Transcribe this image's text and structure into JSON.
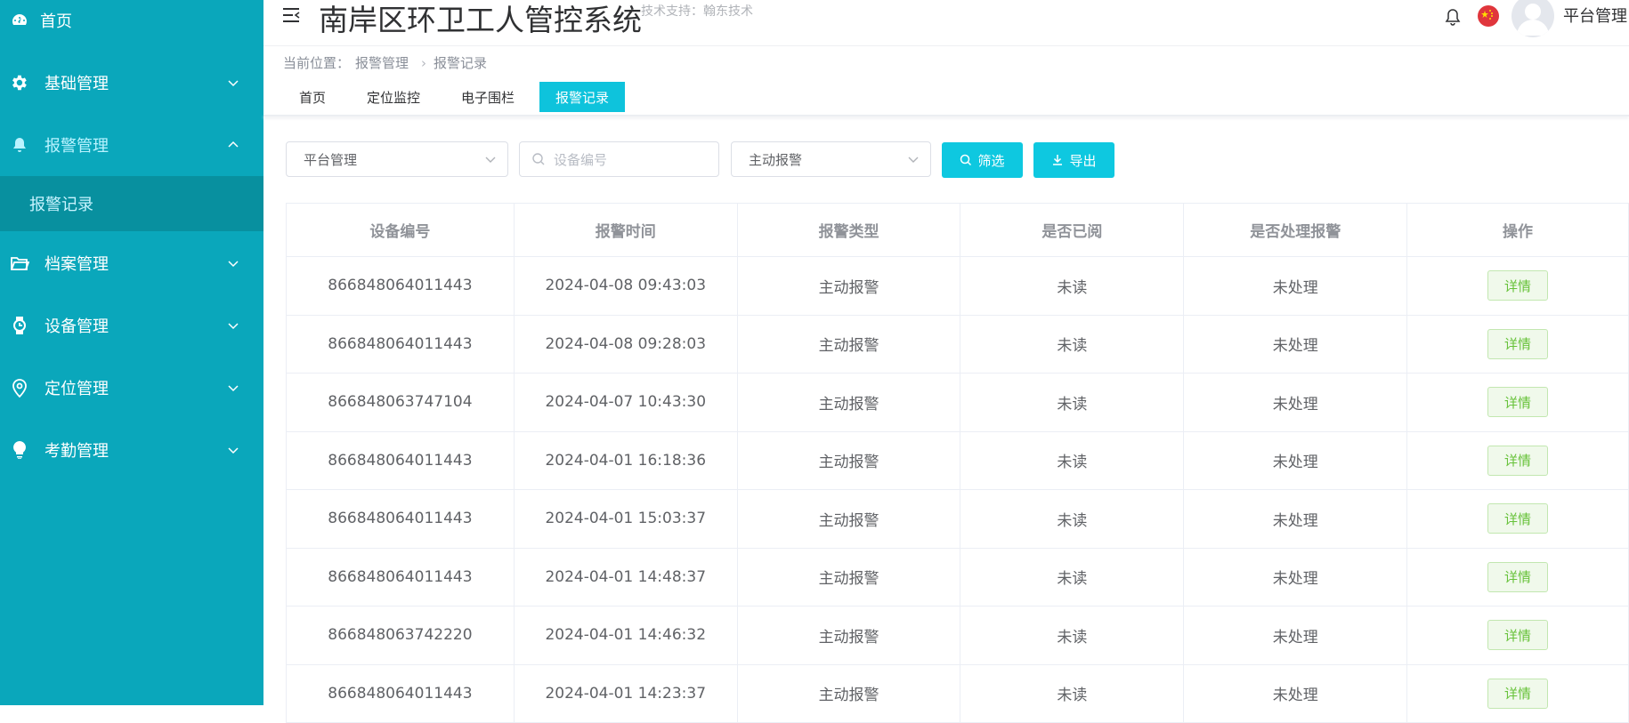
{
  "sidebar": {
    "items": [
      {
        "label": "首页",
        "icon": "dashboard-icon"
      },
      {
        "label": "基础管理",
        "icon": "gear-icon"
      },
      {
        "label": "报警管理",
        "icon": "bell-icon"
      },
      {
        "label": "档案管理",
        "icon": "folder-icon"
      },
      {
        "label": "设备管理",
        "icon": "watch-icon"
      },
      {
        "label": "定位管理",
        "icon": "location-icon"
      },
      {
        "label": "考勤管理",
        "icon": "bulb-icon"
      }
    ],
    "submenu": {
      "label": "报警记录"
    }
  },
  "header": {
    "title": "南岸区环卫工人管控系统",
    "tech_support": "技术支持：翰东技术",
    "user": "平台管理"
  },
  "breadcrumb": {
    "prefix": "当前位置：",
    "items": [
      "报警管理",
      "报警记录"
    ]
  },
  "tabs": [
    "首页",
    "定位监控",
    "电子围栏",
    "报警记录"
  ],
  "filters": {
    "org_select": "平台管理",
    "device_placeholder": "设备编号",
    "type_select": "主动报警",
    "filter_button": "筛选",
    "export_button": "导出"
  },
  "table": {
    "headers": [
      "设备编号",
      "报警时间",
      "报警类型",
      "是否已阅",
      "是否处理报警",
      "操作"
    ],
    "rows": [
      [
        "866848064011443",
        "2024-04-08 09:43:03",
        "主动报警",
        "未读",
        "未处理",
        "详情"
      ],
      [
        "866848064011443",
        "2024-04-08 09:28:03",
        "主动报警",
        "未读",
        "未处理",
        "详情"
      ],
      [
        "866848063747104",
        "2024-04-07 10:43:30",
        "主动报警",
        "未读",
        "未处理",
        "详情"
      ],
      [
        "866848064011443",
        "2024-04-01 16:18:36",
        "主动报警",
        "未读",
        "未处理",
        "详情"
      ],
      [
        "866848064011443",
        "2024-04-01 15:03:37",
        "主动报警",
        "未读",
        "未处理",
        "详情"
      ],
      [
        "866848064011443",
        "2024-04-01 14:48:37",
        "主动报警",
        "未读",
        "未处理",
        "详情"
      ],
      [
        "866848063742220",
        "2024-04-01 14:46:32",
        "主动报警",
        "未读",
        "未处理",
        "详情"
      ],
      [
        "866848064011443",
        "2024-04-01 14:23:37",
        "主动报警",
        "未读",
        "未处理",
        "详情"
      ]
    ]
  },
  "colors": {
    "sidebar": "#0aa7bb",
    "accent": "#0ec8e0",
    "detail_green": "#67c23a"
  }
}
